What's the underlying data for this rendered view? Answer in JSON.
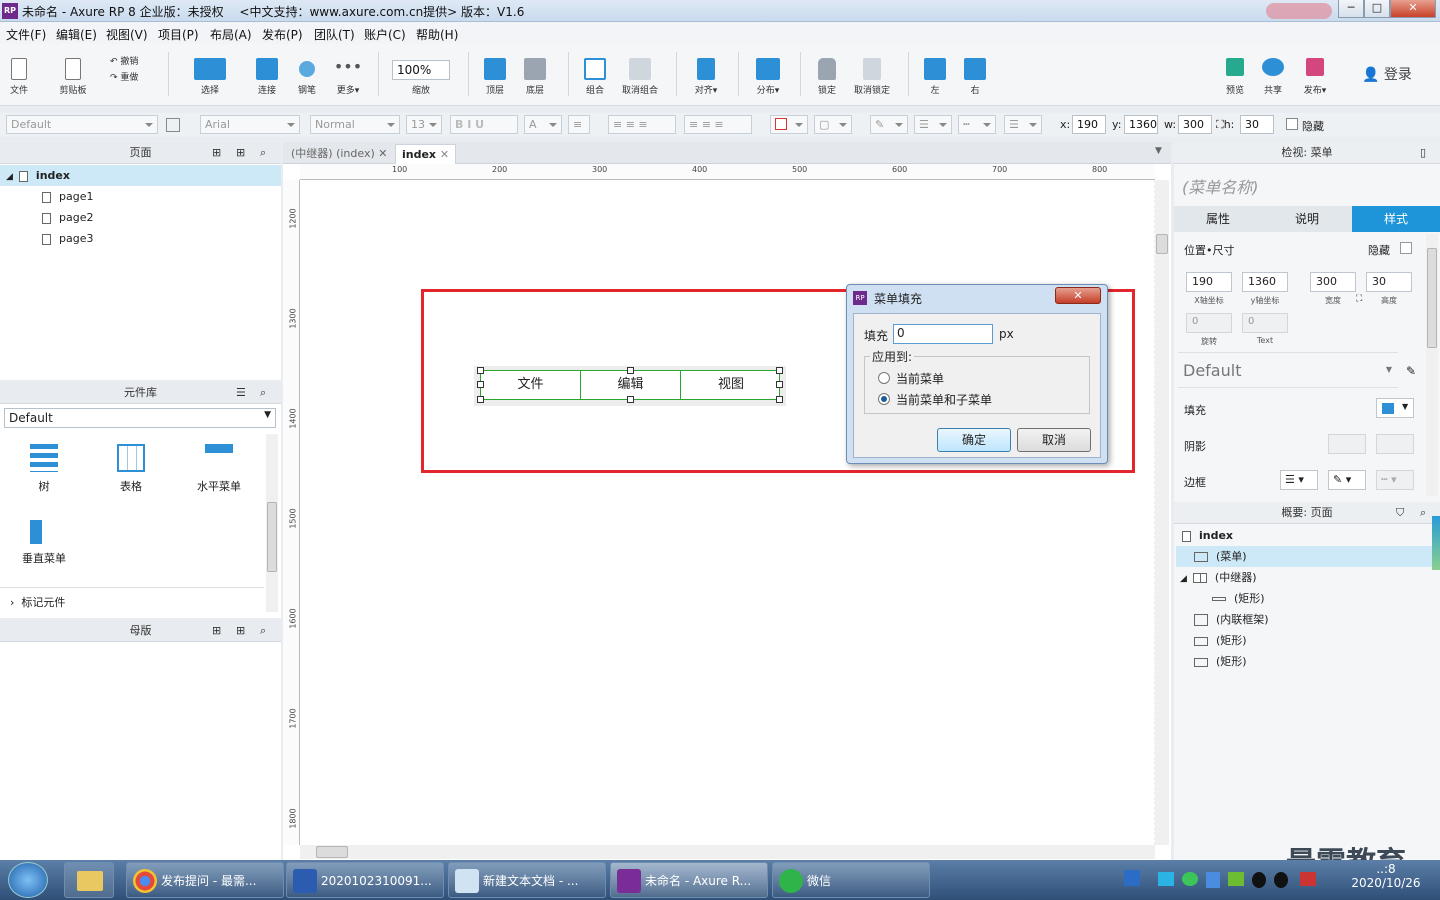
{
  "window": {
    "title": "未命名 - Axure RP 8 企业版：未授权　 <中文支持：www.axure.com.cn提供> 版本：V1.6",
    "logo_text": "RP",
    "minimize": "─",
    "maximize": "□",
    "close": "✕"
  },
  "menubar": [
    "文件(F)",
    "编辑(E)",
    "视图(V)",
    "项目(P)",
    "布局(A)",
    "发布(P)",
    "团队(T)",
    "账户(C)",
    "帮助(H)"
  ],
  "toolbar": {
    "file": "文件",
    "clipboard": "剪贴板",
    "undo": "撤销",
    "redo": "重做",
    "select": "选择",
    "connect": "连接",
    "pen": "钢笔",
    "more": "更多▾",
    "zoom_value": "100%",
    "zoom_label": "缩放",
    "top": "顶层",
    "bottom": "底层",
    "group": "组合",
    "ungroup": "取消组合",
    "align": "对齐▾",
    "distribute": "分布▾",
    "lock": "锁定",
    "unlock": "取消锁定",
    "left": "左",
    "right": "右",
    "preview": "预览",
    "share": "共享",
    "publish": "发布▾",
    "login": "登录"
  },
  "formatbar": {
    "style": "Default",
    "font": "Arial",
    "weight": "Normal",
    "size": "13",
    "x_label": "x:",
    "x": "190",
    "y_label": "y:",
    "y": "1360",
    "w_label": "w:",
    "w": "300",
    "h_label": "h:",
    "h": "30",
    "hidden": "隐藏"
  },
  "pages_panel": {
    "title": "页面",
    "pages": [
      {
        "label": "index"
      },
      {
        "label": "page1"
      },
      {
        "label": "page2"
      },
      {
        "label": "page3"
      }
    ]
  },
  "library_panel": {
    "title": "元件库",
    "selected_library": "Default",
    "widgets": [
      "树",
      "表格",
      "水平菜单",
      "垂直菜单"
    ],
    "marked": "标记元件"
  },
  "masters_panel": {
    "title": "母版"
  },
  "tabs": [
    {
      "label": "(中继器) (index)"
    },
    {
      "label": "index"
    }
  ],
  "ruler_h": [
    "100",
    "200",
    "300",
    "400",
    "500",
    "600",
    "700",
    "800"
  ],
  "ruler_v": [
    "1200",
    "1300",
    "1400",
    "1500",
    "1600",
    "1700",
    "1800"
  ],
  "menu_widget": [
    "文件",
    "编辑",
    "视图"
  ],
  "dialog": {
    "title": "菜单填充",
    "fill_label": "填充",
    "fill_value": "0",
    "unit": "px",
    "apply_to": "应用到:",
    "option_current": "当前菜单",
    "option_sub": "当前菜单和子菜单",
    "selected": "option_sub",
    "ok": "确定",
    "cancel": "取消"
  },
  "inspector": {
    "header": "检视: 菜单",
    "name_placeholder": "(菜单名称)",
    "tabs": [
      "属性",
      "说明",
      "样式"
    ],
    "active_tab": "样式",
    "pos_size": "位置•尺寸",
    "hidden": "隐藏",
    "x": "190",
    "y": "1360",
    "w": "300",
    "h": "30",
    "x_lbl": "X轴坐标",
    "y_lbl": "y轴坐标",
    "w_lbl": "宽度",
    "h_lbl": "高度",
    "rotate": "0",
    "rotate_lbl": "旋转",
    "text_rotate": "0",
    "text_lbl": "Text",
    "style": "Default",
    "fill": "填充",
    "shadow": "阴影",
    "border": "边框",
    "fill_color": "#2d8fd5"
  },
  "outline": {
    "header": "概要: 页面",
    "items": [
      {
        "label": "index",
        "level": 0
      },
      {
        "label": "(菜单)",
        "level": 1
      },
      {
        "label": "(中继器)",
        "level": 1
      },
      {
        "label": "(矩形)",
        "level": 2
      },
      {
        "label": "(内联框架)",
        "level": 1
      },
      {
        "label": "(矩形)",
        "level": 1
      },
      {
        "label": "(矩形)",
        "level": 1
      }
    ]
  },
  "taskbar": {
    "items": [
      "发布提问 - 最需...",
      "2020102310091...",
      "新建文本文档 - ...",
      "未命名 - Axure R...",
      "微信"
    ],
    "date": "2020/10/26",
    "time": "..:8"
  },
  "watermark": "最需教育"
}
